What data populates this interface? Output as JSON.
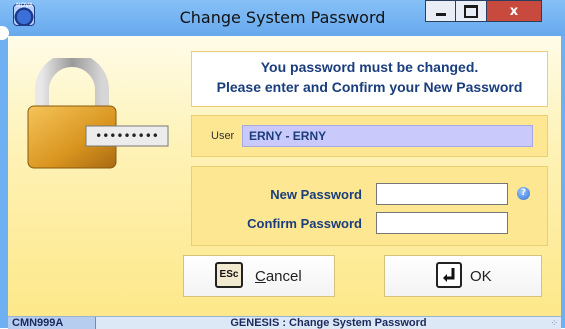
{
  "window": {
    "title": "Change System Password",
    "icon_name": "app-globe-icon",
    "icon_text": "NOVA",
    "controls": {
      "minimize": "minimize-icon",
      "maximize": "maximize-icon",
      "close_label": "x"
    }
  },
  "message": {
    "line1": "You password must be changed.",
    "line2": "Please enter and Confirm your New Password"
  },
  "user": {
    "label": "User",
    "value": "ERNY - ERNY"
  },
  "password": {
    "new_label": "New Password",
    "confirm_label": "Confirm Password",
    "new_value": "",
    "confirm_value": "",
    "help_glyph": "?"
  },
  "lock_illustration": {
    "masked_text": "•••••••••"
  },
  "buttons": {
    "cancel": {
      "key_label": "ESc",
      "label": "Cancel"
    },
    "ok": {
      "label": "OK"
    }
  },
  "status": {
    "code": "CMN999A",
    "text": "GENESIS : Change System Password"
  },
  "colors": {
    "titlebar": "#6fb0f2",
    "panel": "#fde792",
    "accent_text": "#1a3d7c",
    "user_field": "#c9cafb"
  }
}
